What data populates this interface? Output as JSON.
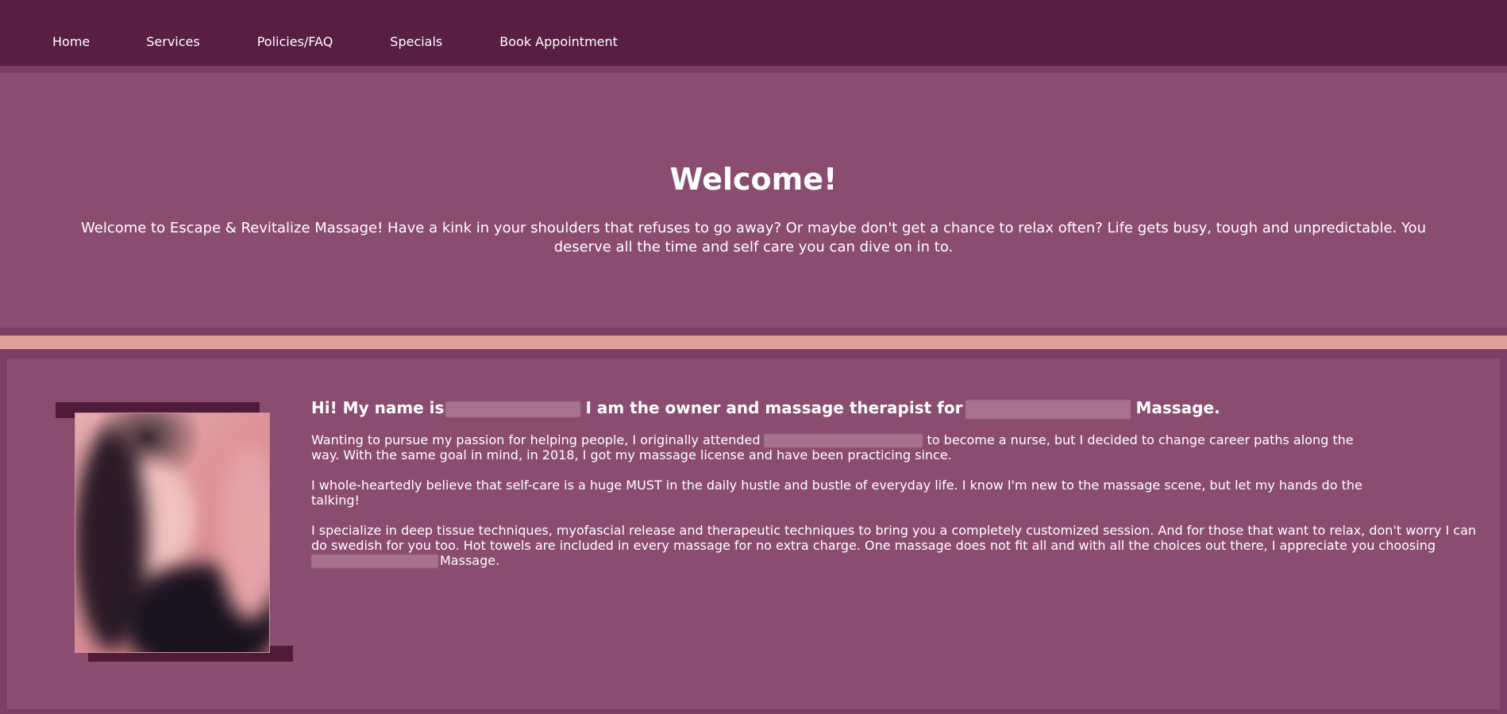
{
  "nav": {
    "items": [
      {
        "label": "Home"
      },
      {
        "label": "Services"
      },
      {
        "label": "Policies/FAQ"
      },
      {
        "label": "Specials"
      },
      {
        "label": "Book Appointment"
      }
    ]
  },
  "hero": {
    "title": "Welcome!",
    "text": "Welcome to Escape & Revitalize Massage! Have a kink in your shoulders that refuses to go away? Or maybe don't get a chance to relax often? Life gets busy, tough and unpredictable. You deserve all the time and self care you can dive on in to."
  },
  "about": {
    "heading_part1": "Hi! My name is",
    "heading_part2": "I am the owner and massage therapist for",
    "heading_part3": "Massage.",
    "p1_part1": "Wanting to pursue my passion for helping people, I originally attended",
    "p1_part2": "to become a nurse, but I decided to change career paths along the way. With the same goal in mind, in 2018, I got my massage license and have been practicing since.",
    "p2": "I whole-heartedly believe that self-care is a huge MUST in the daily hustle and bustle of everyday life. I know I'm new to the massage scene, but let my hands do the talking!",
    "p3_part1": "I specialize in deep tissue techniques, myofascial release and therapeutic techniques to bring you a completely customized session. And for those that want to relax, don't worry I can do swedish for you too. Hot towels are included in every massage for no extra charge. One massage does not fit all and with all the choices out there, I appreciate you choosing",
    "p3_part2": "Massage."
  },
  "colors": {
    "nav_bg": "#571f42",
    "hero_bg": "#8b4d6f",
    "accent_stripe": "#df9f9c",
    "page_bg": "#7b3e64",
    "text": "#ffffff"
  }
}
